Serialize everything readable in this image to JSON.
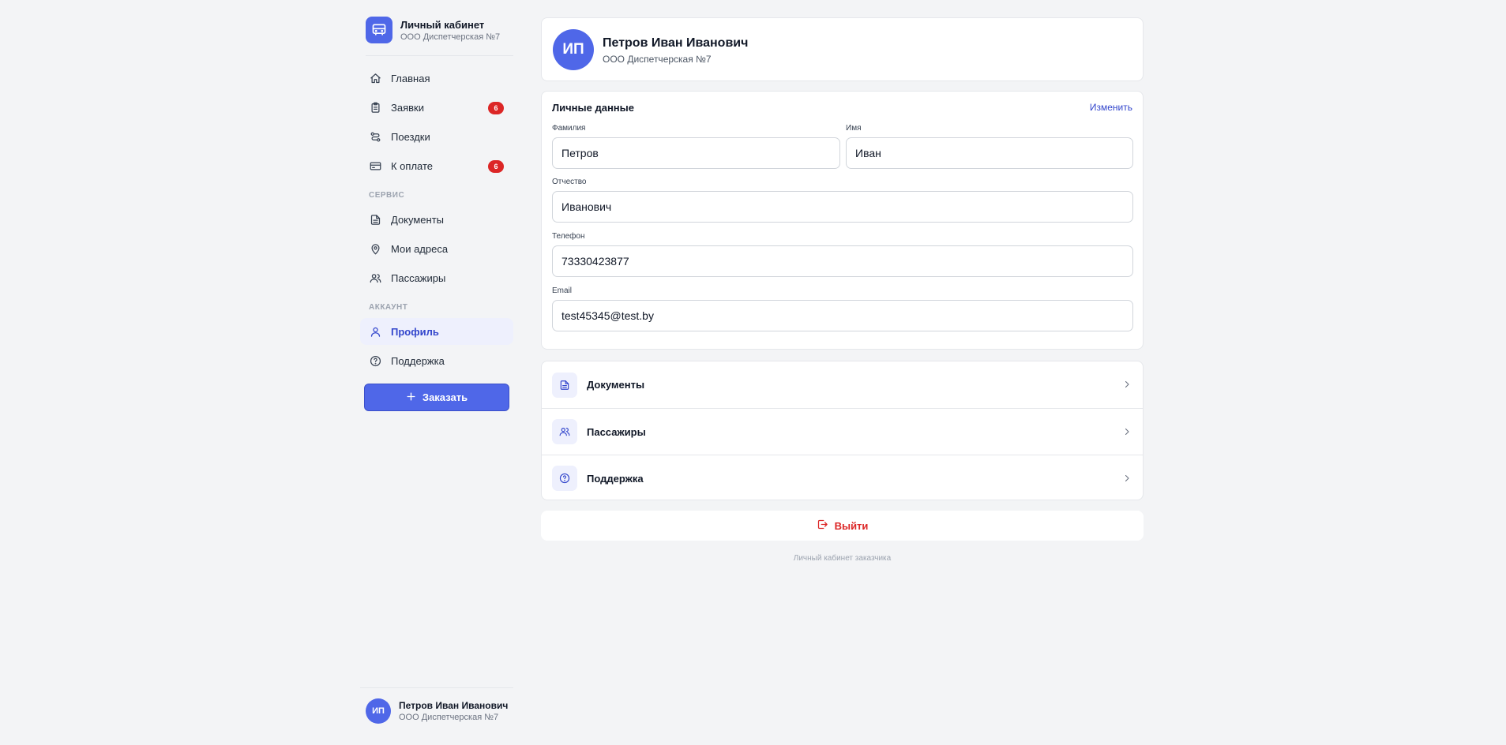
{
  "brand": {
    "title": "Личный кабинет",
    "subtitle": "ООО Диспетчерская №7",
    "icon": "bus-icon",
    "accent": "#4f67e8"
  },
  "sidebar": {
    "main_items": [
      {
        "label": "Главная",
        "icon": "home-icon"
      },
      {
        "label": "Заявки",
        "icon": "clipboard-icon",
        "badge": "6"
      },
      {
        "label": "Поездки",
        "icon": "route-icon"
      },
      {
        "label": "К оплате",
        "icon": "credit-card-icon",
        "badge": "6"
      }
    ],
    "service_label": "СЕРВИС",
    "service_items": [
      {
        "label": "Документы",
        "icon": "document-icon"
      },
      {
        "label": "Мои адреса",
        "icon": "map-pin-icon"
      },
      {
        "label": "Пассажиры",
        "icon": "users-icon"
      }
    ],
    "account_label": "АККАУНТ",
    "account_items": [
      {
        "label": "Профиль",
        "icon": "user-icon",
        "active": true
      },
      {
        "label": "Поддержка",
        "icon": "help-circle-icon"
      }
    ],
    "order_button": "Заказать",
    "user": {
      "initials": "ИП",
      "name": "Петров Иван Иванович",
      "org": "ООО Диспетчерская №7"
    }
  },
  "profile": {
    "initials": "ИП",
    "name": "Петров Иван Иванович",
    "org": "ООО Диспетчерская №7"
  },
  "personal": {
    "title": "Личные данные",
    "edit_label": "Изменить",
    "fields": {
      "last_name": {
        "label": "Фамилия",
        "value": "Петров"
      },
      "first_name": {
        "label": "Имя",
        "value": "Иван"
      },
      "middle_name": {
        "label": "Отчество",
        "value": "Иванович"
      },
      "phone": {
        "label": "Телефон",
        "value": "73330423877"
      },
      "email": {
        "label": "Email",
        "value": "test45345@test.by"
      }
    }
  },
  "links": [
    {
      "label": "Документы",
      "icon": "document-icon"
    },
    {
      "label": "Пассажиры",
      "icon": "users-icon"
    },
    {
      "label": "Поддержка",
      "icon": "help-circle-icon"
    }
  ],
  "logout_label": "Выйти",
  "footer_note": "Личный кабинет заказчика",
  "colors": {
    "accent": "#4f67e8",
    "active_text": "#3346cc",
    "danger": "#dc2626",
    "background": "#f3f4f6"
  }
}
